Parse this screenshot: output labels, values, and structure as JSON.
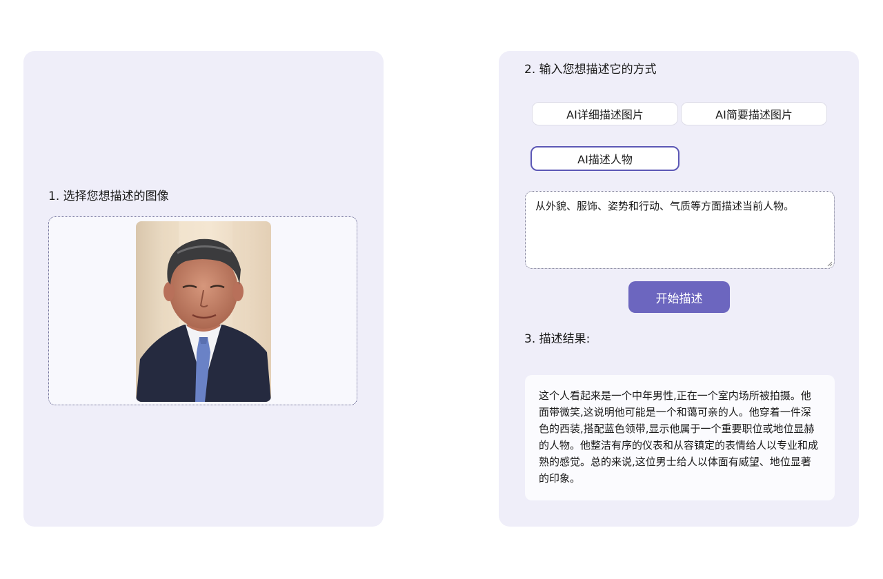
{
  "left": {
    "title": "1. 选择您想描述的图像"
  },
  "right": {
    "title": "2. 输入您想描述它的方式",
    "options": [
      {
        "label": "AI详细描述图片"
      },
      {
        "label": "AI简要描述图片"
      },
      {
        "label": "AI描述人物",
        "selected": true
      }
    ],
    "prompt_text": "从外貌、服饰、姿势和行动、气质等方面描述当前人物。",
    "start_label": "开始描述",
    "result_title": "3. 描述结果:",
    "result_text": "这个人看起来是一个中年男性,正在一个室内场所被拍摄。他面带微笑,这说明他可能是一个和蔼可亲的人。他穿着一件深色的西装,搭配蓝色领带,显示他属于一个重要职位或地位显赫的人物。他整洁有序的仪表和从容镇定的表情给人以专业和成熟的感觉。总的来说,这位男士给人以体面有威望、地位显著的印象。"
  },
  "colors": {
    "panel_bg": "#efeef9",
    "accent": "#6c66bf",
    "selected_border": "#5b57b5"
  }
}
